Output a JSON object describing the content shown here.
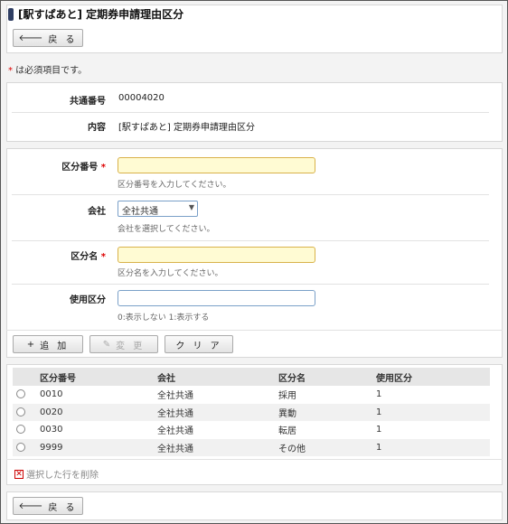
{
  "title": "[駅すぱあと] 定期券申請理由区分",
  "back_label": "戻 る",
  "required_note": " は必須項目です。",
  "required_mark": "*",
  "info": {
    "common_no_label": "共通番号",
    "common_no_value": "00004020",
    "content_label": "内容",
    "content_value": "[駅すぱあと] 定期券申請理由区分"
  },
  "form": {
    "code_label": "区分番号",
    "code_hint": "区分番号を入力してください。",
    "company_label": "会社",
    "company_value": "全社共通",
    "company_hint": "会社を選択してください。",
    "name_label": "区分名",
    "name_hint": "区分名を入力してください。",
    "use_label": "使用区分",
    "use_hint": "0:表示しない 1:表示する"
  },
  "actions": {
    "add": "追 加",
    "change": "変 更",
    "clear": "ク リ ア"
  },
  "table": {
    "headers": [
      "区分番号",
      "会社",
      "区分名",
      "使用区分"
    ],
    "rows": [
      [
        "0010",
        "全社共通",
        "採用",
        "1"
      ],
      [
        "0020",
        "全社共通",
        "異動",
        "1"
      ],
      [
        "0030",
        "全社共通",
        "転居",
        "1"
      ],
      [
        "9999",
        "全社共通",
        "その他",
        "1"
      ]
    ]
  },
  "delete_label": "選択した行を削除"
}
